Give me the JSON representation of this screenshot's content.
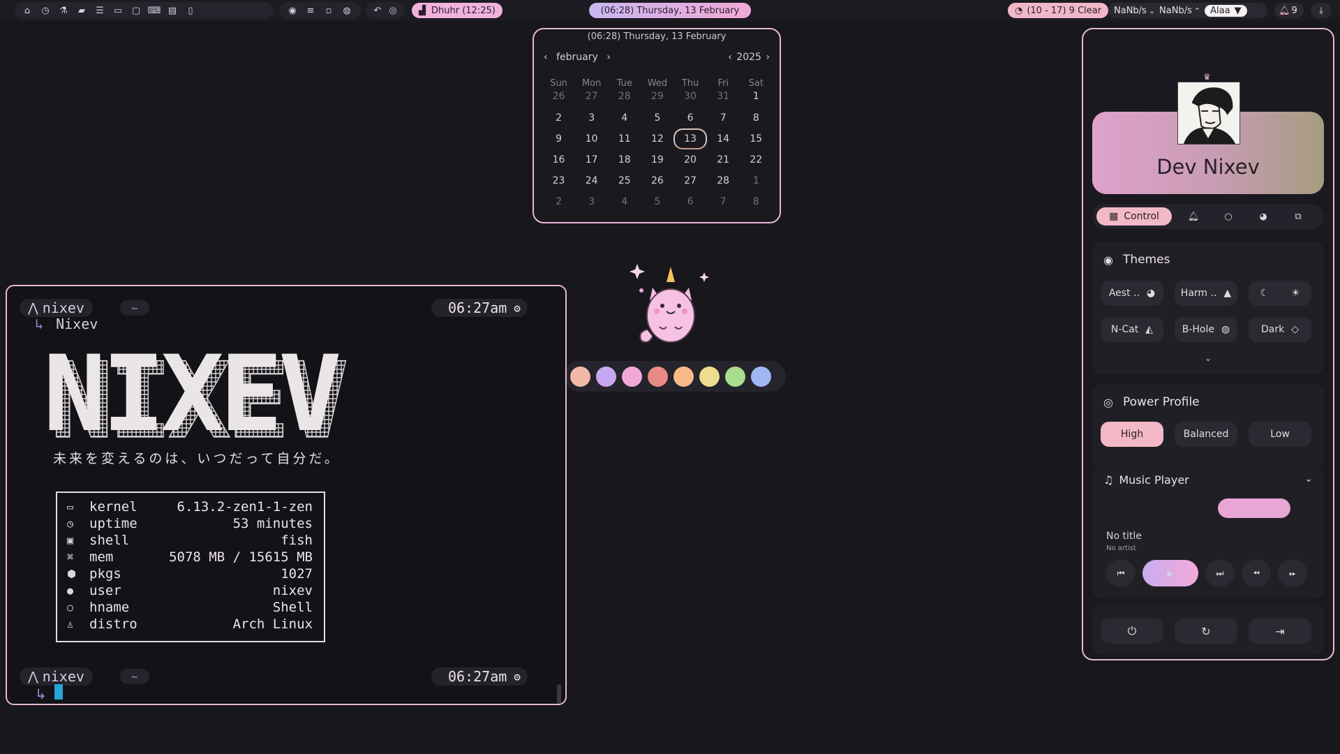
{
  "topbar": {
    "left_icons": [
      "home-icon",
      "clock-icon",
      "flask-icon",
      "folder-icon",
      "database-icon",
      "chat-icon",
      "window-icon",
      "keyboard-icon",
      "document-icon",
      "phone-icon"
    ],
    "media_icons": [
      "bluetooth-icon",
      "stack-icon",
      "record-icon",
      "mic-icon"
    ],
    "extra_icons": [
      "undo-icon",
      "target-icon"
    ],
    "prayer": "Dhuhr (12:25)",
    "datetime": "(06:28) Thursday, 13 February",
    "weather": "(10 - 17) 9 Clear",
    "net_down": "NaNb/s",
    "net_up": "NaNb/s",
    "wifi_name": "Alaa",
    "notifications": "9"
  },
  "calendar": {
    "header": "(06:28) Thursday, 13 February",
    "month": "february",
    "year": "2025",
    "weekdays": [
      "Sun",
      "Mon",
      "Tue",
      "Wed",
      "Thu",
      "Fri",
      "Sat"
    ],
    "weeks": [
      [
        "26",
        "27",
        "28",
        "29",
        "30",
        "31",
        "1"
      ],
      [
        "2",
        "3",
        "4",
        "5",
        "6",
        "7",
        "8"
      ],
      [
        "9",
        "10",
        "11",
        "12",
        "13",
        "14",
        "15"
      ],
      [
        "16",
        "17",
        "18",
        "19",
        "20",
        "21",
        "22"
      ],
      [
        "23",
        "24",
        "25",
        "26",
        "27",
        "28",
        "1"
      ],
      [
        "2",
        "3",
        "4",
        "5",
        "6",
        "7",
        "8"
      ]
    ],
    "today": "13"
  },
  "terminal": {
    "user": "nixev",
    "tilde": "~",
    "time": "06:27am",
    "host_label": "Nixev",
    "logo_text": "NIXEV",
    "tagline": "未来を変えるのは、いつだって自分だ。",
    "info": [
      {
        "icon": "laptop-icon",
        "key": "kernel",
        "value": "6.13.2-zen1-1-zen"
      },
      {
        "icon": "clock-icon",
        "key": "uptime",
        "value": "53 minutes"
      },
      {
        "icon": "terminal-icon",
        "key": "shell",
        "value": "fish"
      },
      {
        "icon": "chip-icon",
        "key": "mem",
        "value": "5078 MB / 15615 MB"
      },
      {
        "icon": "package-icon",
        "key": "pkgs",
        "value": "1027"
      },
      {
        "icon": "user-icon",
        "key": "user",
        "value": "nixev"
      },
      {
        "icon": "circle-icon",
        "key": "hname",
        "value": "Shell"
      },
      {
        "icon": "linux-icon",
        "key": "distro",
        "value": "Arch Linux"
      }
    ]
  },
  "swatches": [
    "#f2b8a8",
    "#c7a7ef",
    "#f0a9d6",
    "#ea8a84",
    "#f6b987",
    "#eedc8f",
    "#a8dc8e",
    "#9fb6f2"
  ],
  "panel": {
    "name": "Dev Nixev",
    "tabs": {
      "control": "Control"
    },
    "themes": {
      "title": "Themes",
      "buttons": [
        {
          "label": "Aest ..",
          "icon": "palette-icon"
        },
        {
          "label": "Harm ..",
          "icon": "mountain-icon"
        },
        {
          "label": "N-Cat",
          "icon": "cat-icon"
        },
        {
          "label": "B-Hole",
          "icon": "swirl-icon"
        },
        {
          "label": "Dark",
          "icon": "diamond-icon"
        }
      ]
    },
    "power": {
      "title": "Power Profile",
      "high": "High",
      "balanced": "Balanced",
      "low": "Low",
      "active": "High"
    },
    "music": {
      "title": "Music Player",
      "track_title": "No title",
      "artist": "No artist"
    }
  },
  "colors": {
    "accent_border": "#e8b7d8",
    "active_pill": "#f2b9c7",
    "cursor": "#29a3d8"
  }
}
